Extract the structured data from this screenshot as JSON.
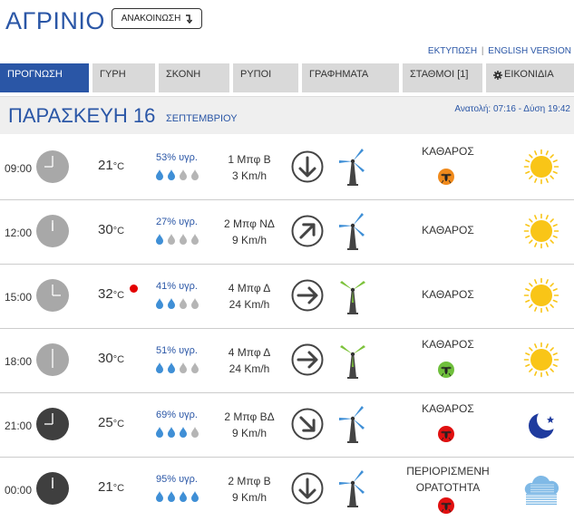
{
  "header": {
    "city": "ΑΓΡΙΝΙΟ",
    "announce_label": "ΑΝΑΚΟΙΝΩΣΗ",
    "print_link": "ΕΚΤΥΠΩΣΗ",
    "separator": "|",
    "english_link": "ENGLISH VERSION"
  },
  "tabs": [
    {
      "label": "ΠΡΟΓΝΩΣΗ",
      "active": true
    },
    {
      "label": "ΓΥΡΗ",
      "active": false
    },
    {
      "label": "ΣΚΟΝΗ",
      "active": false
    },
    {
      "label": "ΡΥΠΟΙ",
      "active": false
    },
    {
      "label": "ΓΡΑΦΗΜΑΤΑ",
      "active": false
    },
    {
      "label": "ΣΤΑΘΜΟΙ [1]",
      "active": false
    },
    {
      "label": "ΕΙΚΟΝΙΔΙΑ",
      "active": false
    }
  ],
  "day": {
    "name": "ΠΑΡΑΣΚΕΥΗ 16",
    "month": "ΣΕΠΤΕΜΒΡΙΟΥ",
    "sun": "Ανατολή: 07:16  - Δύση 19:42"
  },
  "units": {
    "temp": "°C"
  },
  "colors": {
    "accent": "#2a56a6",
    "tab_inactive": "#d9d9d9",
    "clock_day": "#a8a8a8",
    "clock_night": "#3f3f3f",
    "drop_filled": "#3f8fd6",
    "drop_empty": "#b5b5b5",
    "turbine_blue": "#3f8fd6",
    "turbine_green": "#7cc23a",
    "sun_yellow": "#f9c517",
    "moon_blue": "#1f3b9e",
    "bug_orange": "#f08a1c",
    "bug_green": "#6fbf3c",
    "bug_red": "#e01010"
  },
  "rows": [
    {
      "time": "09:00",
      "hour": 9,
      "night": false,
      "temp": "21",
      "alert": false,
      "humidity": "53% υγρ.",
      "drops": 2,
      "wind_beaufort": "1 Μπφ Β",
      "wind_speed": "3 Km/h",
      "wind_dir_deg": 180,
      "turbine": "blue",
      "sky": [
        "ΚΑΘΑΡΟΣ"
      ],
      "bug": "orange",
      "icon": "sun-icon"
    },
    {
      "time": "12:00",
      "hour": 12,
      "night": false,
      "temp": "30",
      "alert": false,
      "humidity": "27% υγρ.",
      "drops": 1,
      "wind_beaufort": "2 Μπφ ΝΔ",
      "wind_speed": "9 Km/h",
      "wind_dir_deg": 45,
      "turbine": "blue",
      "sky": [
        "ΚΑΘΑΡΟΣ"
      ],
      "bug": "",
      "icon": "sun-icon"
    },
    {
      "time": "15:00",
      "hour": 15,
      "night": false,
      "temp": "32",
      "alert": true,
      "humidity": "41% υγρ.",
      "drops": 2,
      "wind_beaufort": "4 Μπφ Δ",
      "wind_speed": "24 Km/h",
      "wind_dir_deg": 90,
      "turbine": "green",
      "sky": [
        "ΚΑΘΑΡΟΣ"
      ],
      "bug": "",
      "icon": "sun-icon"
    },
    {
      "time": "18:00",
      "hour": 18,
      "night": false,
      "temp": "30",
      "alert": false,
      "humidity": "51% υγρ.",
      "drops": 2,
      "wind_beaufort": "4 Μπφ Δ",
      "wind_speed": "24 Km/h",
      "wind_dir_deg": 90,
      "turbine": "green",
      "sky": [
        "ΚΑΘΑΡΟΣ"
      ],
      "bug": "green",
      "icon": "sun-icon"
    },
    {
      "time": "21:00",
      "hour": 21,
      "night": true,
      "temp": "25",
      "alert": false,
      "humidity": "69% υγρ.",
      "drops": 3,
      "wind_beaufort": "2 Μπφ ΒΔ",
      "wind_speed": "9 Km/h",
      "wind_dir_deg": 135,
      "turbine": "blue",
      "sky": [
        "ΚΑΘΑΡΟΣ"
      ],
      "bug": "red",
      "icon": "moon-icon"
    },
    {
      "time": "00:00",
      "hour": 0,
      "night": true,
      "temp": "21",
      "alert": false,
      "humidity": "95% υγρ.",
      "drops": 4,
      "wind_beaufort": "2 Μπφ Β",
      "wind_speed": "9 Km/h",
      "wind_dir_deg": 180,
      "turbine": "blue",
      "sky": [
        "ΠΕΡΙΟΡΙΣΜΕΝΗ",
        "ΟΡΑΤΟΤΗΤΑ"
      ],
      "bug": "red",
      "icon": "fog-icon"
    }
  ]
}
